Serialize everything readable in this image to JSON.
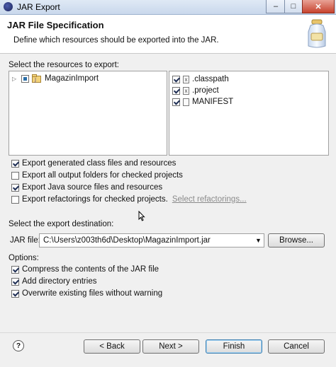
{
  "window": {
    "title": "JAR Export",
    "minimize_glyph": "–",
    "maximize_glyph": "□",
    "close_glyph": "✕"
  },
  "header": {
    "title": "JAR File Specification",
    "description": "Define which resources should be exported into the JAR.",
    "icon": "jar-export-icon"
  },
  "resources": {
    "label": "Select the resources to export:",
    "tree": [
      {
        "label": "MagazinImport",
        "state": "partial",
        "icon": "project-icon",
        "expander": "▷"
      }
    ],
    "files": [
      {
        "label": ".classpath",
        "checked": true,
        "icon": "x-file-icon",
        "glyph": "x"
      },
      {
        "label": ".project",
        "checked": true,
        "icon": "x-file-icon",
        "glyph": "x"
      },
      {
        "label": "MANIFEST",
        "checked": true,
        "icon": "file-icon",
        "glyph": ""
      }
    ]
  },
  "options_top": [
    {
      "label": "Export generated class files and resources",
      "checked": true
    },
    {
      "label": "Export all output folders for checked projects",
      "checked": false
    },
    {
      "label": "Export Java source files and resources",
      "checked": true
    },
    {
      "label": "Export refactorings for checked projects.",
      "checked": false
    }
  ],
  "select_refactorings_link": "Select refactorings...",
  "destination": {
    "label": "Select the export destination:",
    "jar_label": "JAR file:",
    "jar_value": "C:\\Users\\z003th6d\\Desktop\\MagazinImport.jar",
    "browse_label": "Browse..."
  },
  "options": {
    "label": "Options:",
    "items": [
      {
        "label": "Compress the contents of the JAR file",
        "checked": true
      },
      {
        "label": "Add directory entries",
        "checked": true
      },
      {
        "label": "Overwrite existing files without warning",
        "checked": true
      }
    ]
  },
  "footer": {
    "help_glyph": "?",
    "back_label": "< Back",
    "next_label": "Next >",
    "finish_label": "Finish",
    "cancel_label": "Cancel"
  }
}
